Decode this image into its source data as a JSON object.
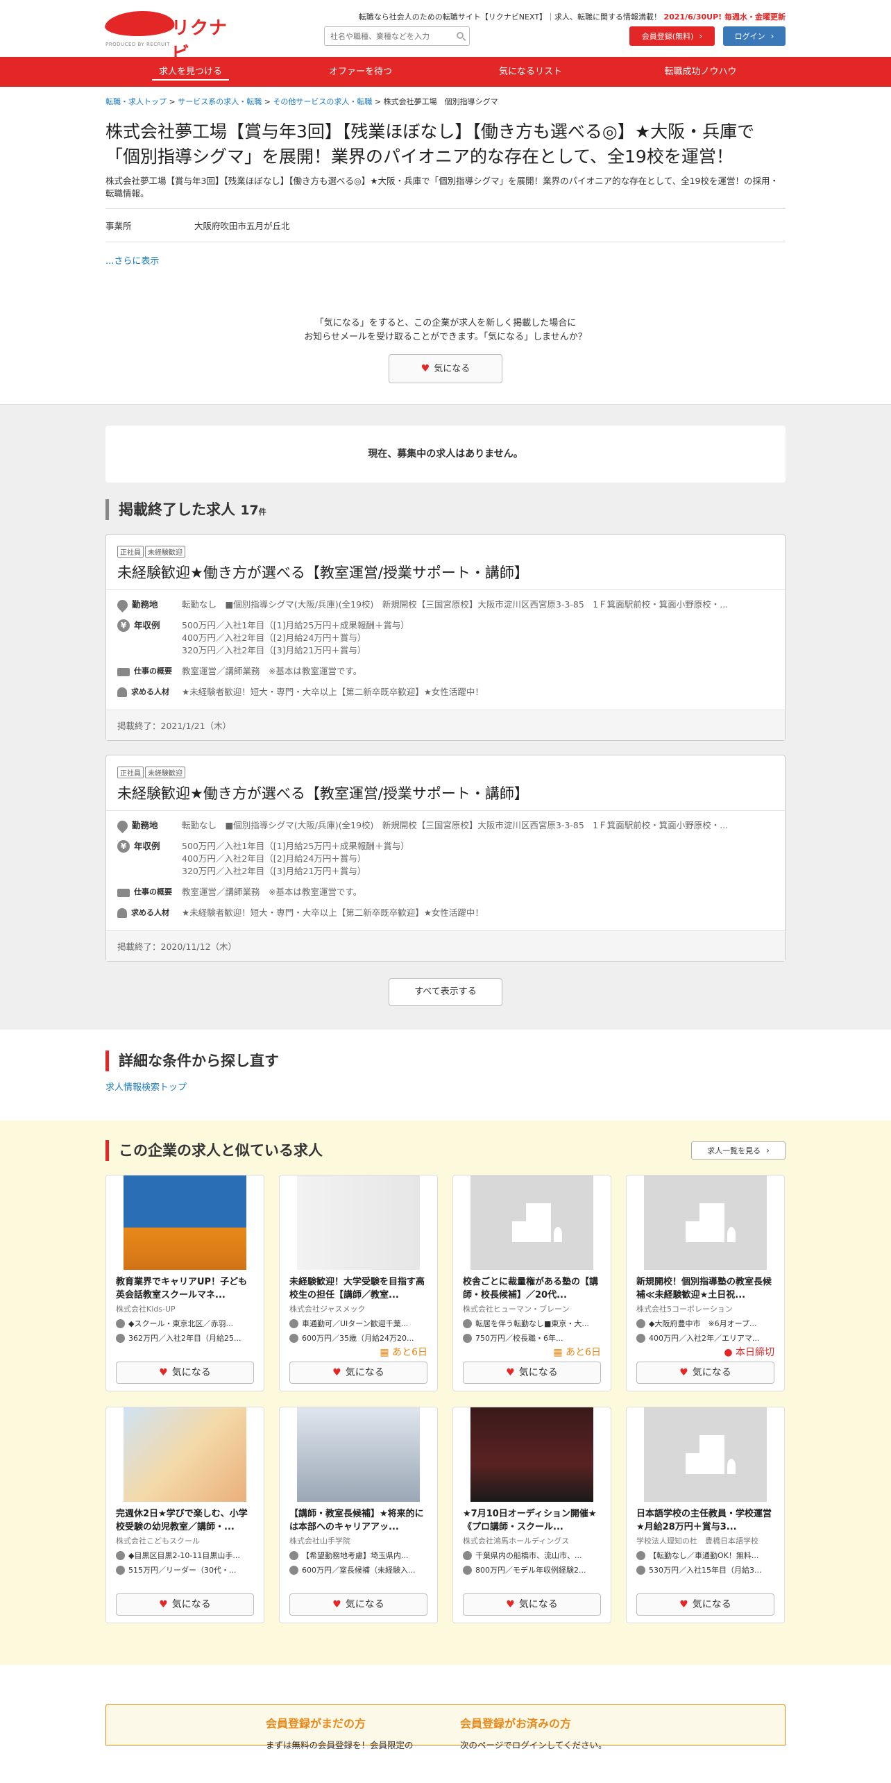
{
  "header": {
    "logo_text": "リクナビNEXT",
    "logo_sub": "PRODUCED BY RECRUIT",
    "tagline": "転職なら社会人のための転職サイト【リクナビNEXT】｜求人、転職に関する情報満載！",
    "update_note": "2021/6/30UP! 毎週水・金曜更新",
    "search_placeholder": "社名や職種、業種などを入力",
    "register_label": "会員登録(無料)",
    "login_label": "ログイン"
  },
  "nav": [
    {
      "label": "求人を見つける"
    },
    {
      "label": "オファーを待つ"
    },
    {
      "label": "気になるリスト"
    },
    {
      "label": "転職成功ノウハウ"
    }
  ],
  "breadcrumb": [
    "転職・求人トップ",
    "サービス系の求人・転職",
    "その他サービスの求人・転職",
    "株式会社夢工場　個別指導シグマ"
  ],
  "company": {
    "title": "株式会社夢工場【賞与年3回】【残業ほぼなし】【働き方も選べる◎】★大阪・兵庫で「個別指導シグマ」を展開！業界のパイオニア的な存在として、全19校を運営！",
    "subtitle": "株式会社夢工場【賞与年3回】【残業ほぼなし】【働き方も選べる◎】★大阪・兵庫で「個別指導シグマ」を展開！業界のパイオニア的な存在として、全19校を運営！の採用・転職情報。",
    "office_label": "事業所",
    "office_value": "大阪府吹田市五月が丘北",
    "more_label": "...さらに表示",
    "fav_msg_1": "「気になる」をすると、この企業が求人を新しく掲載した場合に",
    "fav_msg_2": "お知らせメールを受け取ることができます。「気になる」しませんか？",
    "fav_label": "気になる"
  },
  "jobs_section": {
    "no_jobs": "現在、募集中の求人はありません。",
    "ended_heading": "掲載終了した求人",
    "ended_count": "17",
    "ended_unit": "件",
    "show_all": "すべて表示する",
    "jobs": [
      {
        "tags": [
          "正社員",
          "未経験歓迎"
        ],
        "title": "未経験歓迎★働き方が選べる【教室運営/授業サポート・講師】",
        "location_label": "勤務地",
        "location": "転勤なし　■個別指導シグマ(大阪/兵庫)(全19校)　新規開校【三国宮原校】大阪市淀川区西宮原3-3-85　1Ｆ箕面駅前校・箕面小野原校・...",
        "salary_label": "年収例",
        "salary_1": "500万円／入社1年目（[1]月給25万円＋成果報酬＋賞与）",
        "salary_2": "400万円／入社2年目（[2]月給24万円＋賞与）",
        "salary_3": "320万円／入社2年目（[3]月給21万円＋賞与）",
        "work_label": "仕事の概要",
        "work": "教室運営／講師業務　※基本は教室運営です。",
        "person_label": "求める人材",
        "person": "★未経験者歓迎！短大・専門・大卒以上【第二新卒既卒歓迎】★女性活躍中！",
        "posted": "掲載終了：2021/1/21（木）"
      },
      {
        "tags": [
          "正社員",
          "未経験歓迎"
        ],
        "title": "未経験歓迎★働き方が選べる【教室運営/授業サポート・講師】",
        "location_label": "勤務地",
        "location": "転勤なし　■個別指導シグマ(大阪/兵庫)(全19校)　新規開校【三国宮原校】大阪市淀川区西宮原3-3-85　1Ｆ箕面駅前校・箕面小野原校・...",
        "salary_label": "年収例",
        "salary_1": "500万円／入社1年目（[1]月給25万円＋成果報酬＋賞与）",
        "salary_2": "400万円／入社2年目（[2]月給24万円＋賞与）",
        "salary_3": "320万円／入社2年目（[3]月給21万円＋賞与）",
        "work_label": "仕事の概要",
        "work": "教室運営／講師業務　※基本は教室運営です。",
        "person_label": "求める人材",
        "person": "★未経験者歓迎！短大・専門・大卒以上【第二新卒既卒歓迎】★女性活躍中！",
        "posted": "掲載終了：2020/11/12（木）"
      }
    ]
  },
  "detail_search": {
    "heading": "詳細な条件から探し直す",
    "link": "求人情報検索トップ"
  },
  "similar": {
    "heading": "この企業の求人と似ている求人",
    "list_button": "求人一覧を見る",
    "fav_label": "気になる",
    "cards": [
      {
        "title": "教育業界でキャリアUP！子ども英会話教室スクールマネ...",
        "company": "株式会社Kids-UP",
        "location": "◆スクール・東京北区／赤羽...",
        "salary": "362万円／入社2年目（月給25...",
        "badge": "",
        "image": "kidsup"
      },
      {
        "title": "未経験歓迎！大学受験を目指す高校生の担任【講師／教室...",
        "company": "株式会社ジャスメック",
        "location": "車通勤可／UIターン歓迎千葉...",
        "salary": "600万円／35歳（月給24万20...",
        "badge": "あと6日",
        "image": "people"
      },
      {
        "title": "校舎ごとに裁量権がある塾の【講師・校長候補】／20代...",
        "company": "株式会社ヒューマン・ブレーン",
        "location": "転居を伴う転勤なし■東京・大...",
        "salary": "750万円／校長職・6年...",
        "badge": "あと6日",
        "image": "none"
      },
      {
        "title": "新規開校！個別指導塾の教室長候補≪未経験歓迎★土日祝...",
        "company": "株式会社5コーポレーション",
        "location": "◆大阪府豊中市　※6月オープ...",
        "salary": "400万円／入社2年／エリアマ...",
        "badge": "本日締切",
        "image": "none"
      },
      {
        "title": "完週休2日★学びで楽しむ、小学校受験の幼児教室／講師・...",
        "company": "株式会社こどもスクール",
        "location": "◆目黒区目黒2-10-11目黒山手...",
        "salary": "515万円／リーダー（30代・...",
        "badge": "",
        "image": "kids"
      },
      {
        "title": "【講師・教室長候補】★将来的には本部へのキャリアアッ...",
        "company": "株式会社山手学院",
        "location": "【希望勤務地考慮】埼玉県内...",
        "salary": "600万円／室長候補（未経験入...",
        "badge": "",
        "image": "class"
      },
      {
        "title": "★7月10日オーディション開催★《プロ講師・スクール...",
        "company": "株式会社鴻馬ホールディングス",
        "location": "千葉県内の船橋市、流山市、...",
        "salary": "800万円／モデル年収例経験2...",
        "badge": "",
        "image": "stage"
      },
      {
        "title": "日本語学校の主任教員・学校運営★月給28万円＋賞与3...",
        "company": "学校法人理知の杜　豊橋日本語学校",
        "location": "【転勤なし／車通勤OK！無料...",
        "salary": "530万円／入社15年目（月給3...",
        "badge": "",
        "image": "none"
      }
    ]
  },
  "bottom": {
    "not_member_heading": "会員登録がまだの方",
    "not_member_text": "まずは無料の会員登録を！会員限定の",
    "member_heading": "会員登録がお済みの方",
    "member_text": "次のページでログインしてください。"
  },
  "colors": {
    "brand_red": "#e32626",
    "link_blue": "#1a7ac0",
    "login_blue": "#3a78b8",
    "orange": "#e8891a"
  }
}
